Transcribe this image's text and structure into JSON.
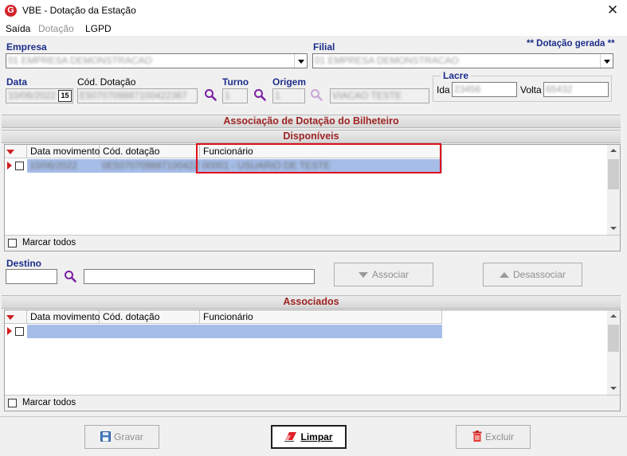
{
  "window": {
    "title": "VBE - Dotação da Estação",
    "close_glyph": "✕"
  },
  "menu": {
    "items": [
      "Saída",
      "Dotação",
      "LGPD"
    ]
  },
  "form": {
    "empresa_label": "Empresa",
    "empresa_value": "01 EMPRESA DEMONSTRACAO",
    "filial_label": "Filial",
    "filial_value": "01 EMPRESA DEMONSTRACAO",
    "status_text": "** Dotação gerada **",
    "data_label": "Data",
    "data_value": "10/06/2022",
    "calendar_glyph": "15",
    "cod_dotacao_label": "Cód. Dotação",
    "cod_dotacao_value": "E5070709887100422367",
    "turno_label": "Turno",
    "turno_value": "1",
    "origem_label": "Origem",
    "origem_value": "1",
    "origem_desc": "VIACAO TESTE",
    "lacre_label": "Lacre",
    "ida_label": "Ida",
    "ida_value": "23456",
    "volta_label": "Volta",
    "volta_value": "65432"
  },
  "section_main": "Associação de Dotação do Bilheteiro",
  "disponiveis": {
    "header": "Disponíveis",
    "columns": [
      "Data movimento",
      "Cód. dotação",
      "Funcionário"
    ],
    "rows": [
      {
        "data": "10/06/2022",
        "cod": "0E5070709887100422367",
        "func": "00001 - USUARIO DE TESTE"
      }
    ],
    "marcar_todos": "Marcar todos"
  },
  "destino": {
    "label": "Destino",
    "code": "",
    "desc": ""
  },
  "actions": {
    "associar": "Associar",
    "desassociar": "Desassociar"
  },
  "associados": {
    "header": "Associados",
    "columns": [
      "Data movimento",
      "Cód. dotação",
      "Funcionário"
    ],
    "marcar_todos": "Marcar todos"
  },
  "buttons": {
    "gravar": "Gravar",
    "limpar": "Limpar",
    "excluir": "Excluir"
  },
  "colors": {
    "highlight_border": "#e0101a",
    "label_blue": "#1c2d8a",
    "section_red": "#9d2323",
    "selection": "#a6bde8"
  }
}
